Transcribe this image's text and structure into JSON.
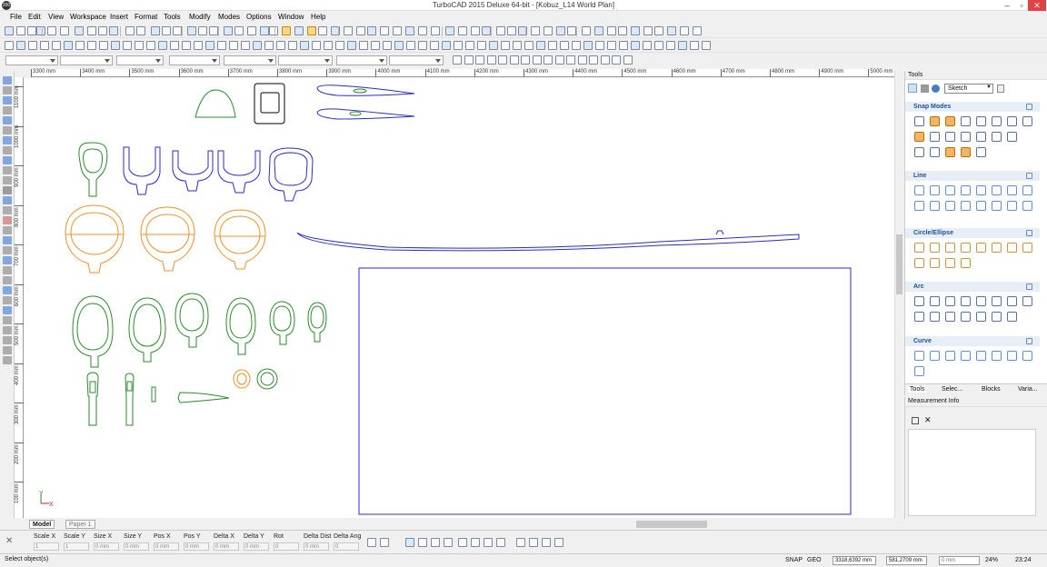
{
  "window": {
    "title": "TurboCAD 2015 Deluxe 64-bit - [Kobuz_L14 World Plan]",
    "icon_label": "200"
  },
  "menu": [
    "File",
    "Edit",
    "View",
    "Workspace",
    "Insert",
    "Format",
    "Tools",
    "Modify",
    "Modes",
    "Options",
    "Window",
    "Help"
  ],
  "ruler": {
    "h_labels": [
      "3300 mm",
      "3400 mm",
      "3500 mm",
      "3600 mm",
      "3700 mm",
      "3800 mm",
      "3900 mm",
      "4000 mm",
      "4100 mm",
      "4200 mm",
      "4300 mm",
      "4400 mm",
      "4500 mm",
      "4600 mm",
      "4700 mm",
      "4800 mm",
      "4900 mm",
      "5000 mm"
    ],
    "v_labels": [
      "1100 mm",
      "1000 mm",
      "900 mm",
      "800 mm",
      "700 mm",
      "600 mm",
      "500 mm",
      "400 mm",
      "300 mm",
      "200 mm",
      "100 mm"
    ]
  },
  "layout_tabs": {
    "model": "Model",
    "paper": "Paper 1"
  },
  "panel": {
    "title": "Tools",
    "dropdown_value": "Sketch",
    "sections": [
      "Snap Modes",
      "Line",
      "Circle/Ellipse",
      "Arc",
      "Curve"
    ],
    "tabs": [
      "Tools",
      "Selec...",
      "Blocks",
      "Varia..."
    ]
  },
  "measurement": {
    "title": "Measurement Info"
  },
  "coords": {
    "fields": [
      {
        "label": "Scale X",
        "value": "1"
      },
      {
        "label": "Scale Y",
        "value": "1"
      },
      {
        "label": "Size X",
        "value": "0 mm"
      },
      {
        "label": "Size Y",
        "value": "0 mm"
      },
      {
        "label": "Pos X",
        "value": "0 mm"
      },
      {
        "label": "Pos Y",
        "value": "0 mm"
      },
      {
        "label": "Delta X",
        "value": "0 mm"
      },
      {
        "label": "Delta Y",
        "value": "0 mm"
      },
      {
        "label": "Rot",
        "value": "0"
      },
      {
        "label": "Delta Dist",
        "value": "0 mm"
      },
      {
        "label": "Delta Ang",
        "value": "0"
      }
    ]
  },
  "status": {
    "prompt": "Select object(s)",
    "snap": "SNAP",
    "geo": "GEO",
    "x": "3318,6392 mm",
    "y": "581,2709 mm",
    "z": "0 mm",
    "zoom": "24%",
    "time": "23:24"
  },
  "colors": {
    "green": "#2c8a2c",
    "blue": "#2a2ad0",
    "orange": "#f0902a",
    "black": "#000000",
    "accent": "#1c4f9a"
  }
}
